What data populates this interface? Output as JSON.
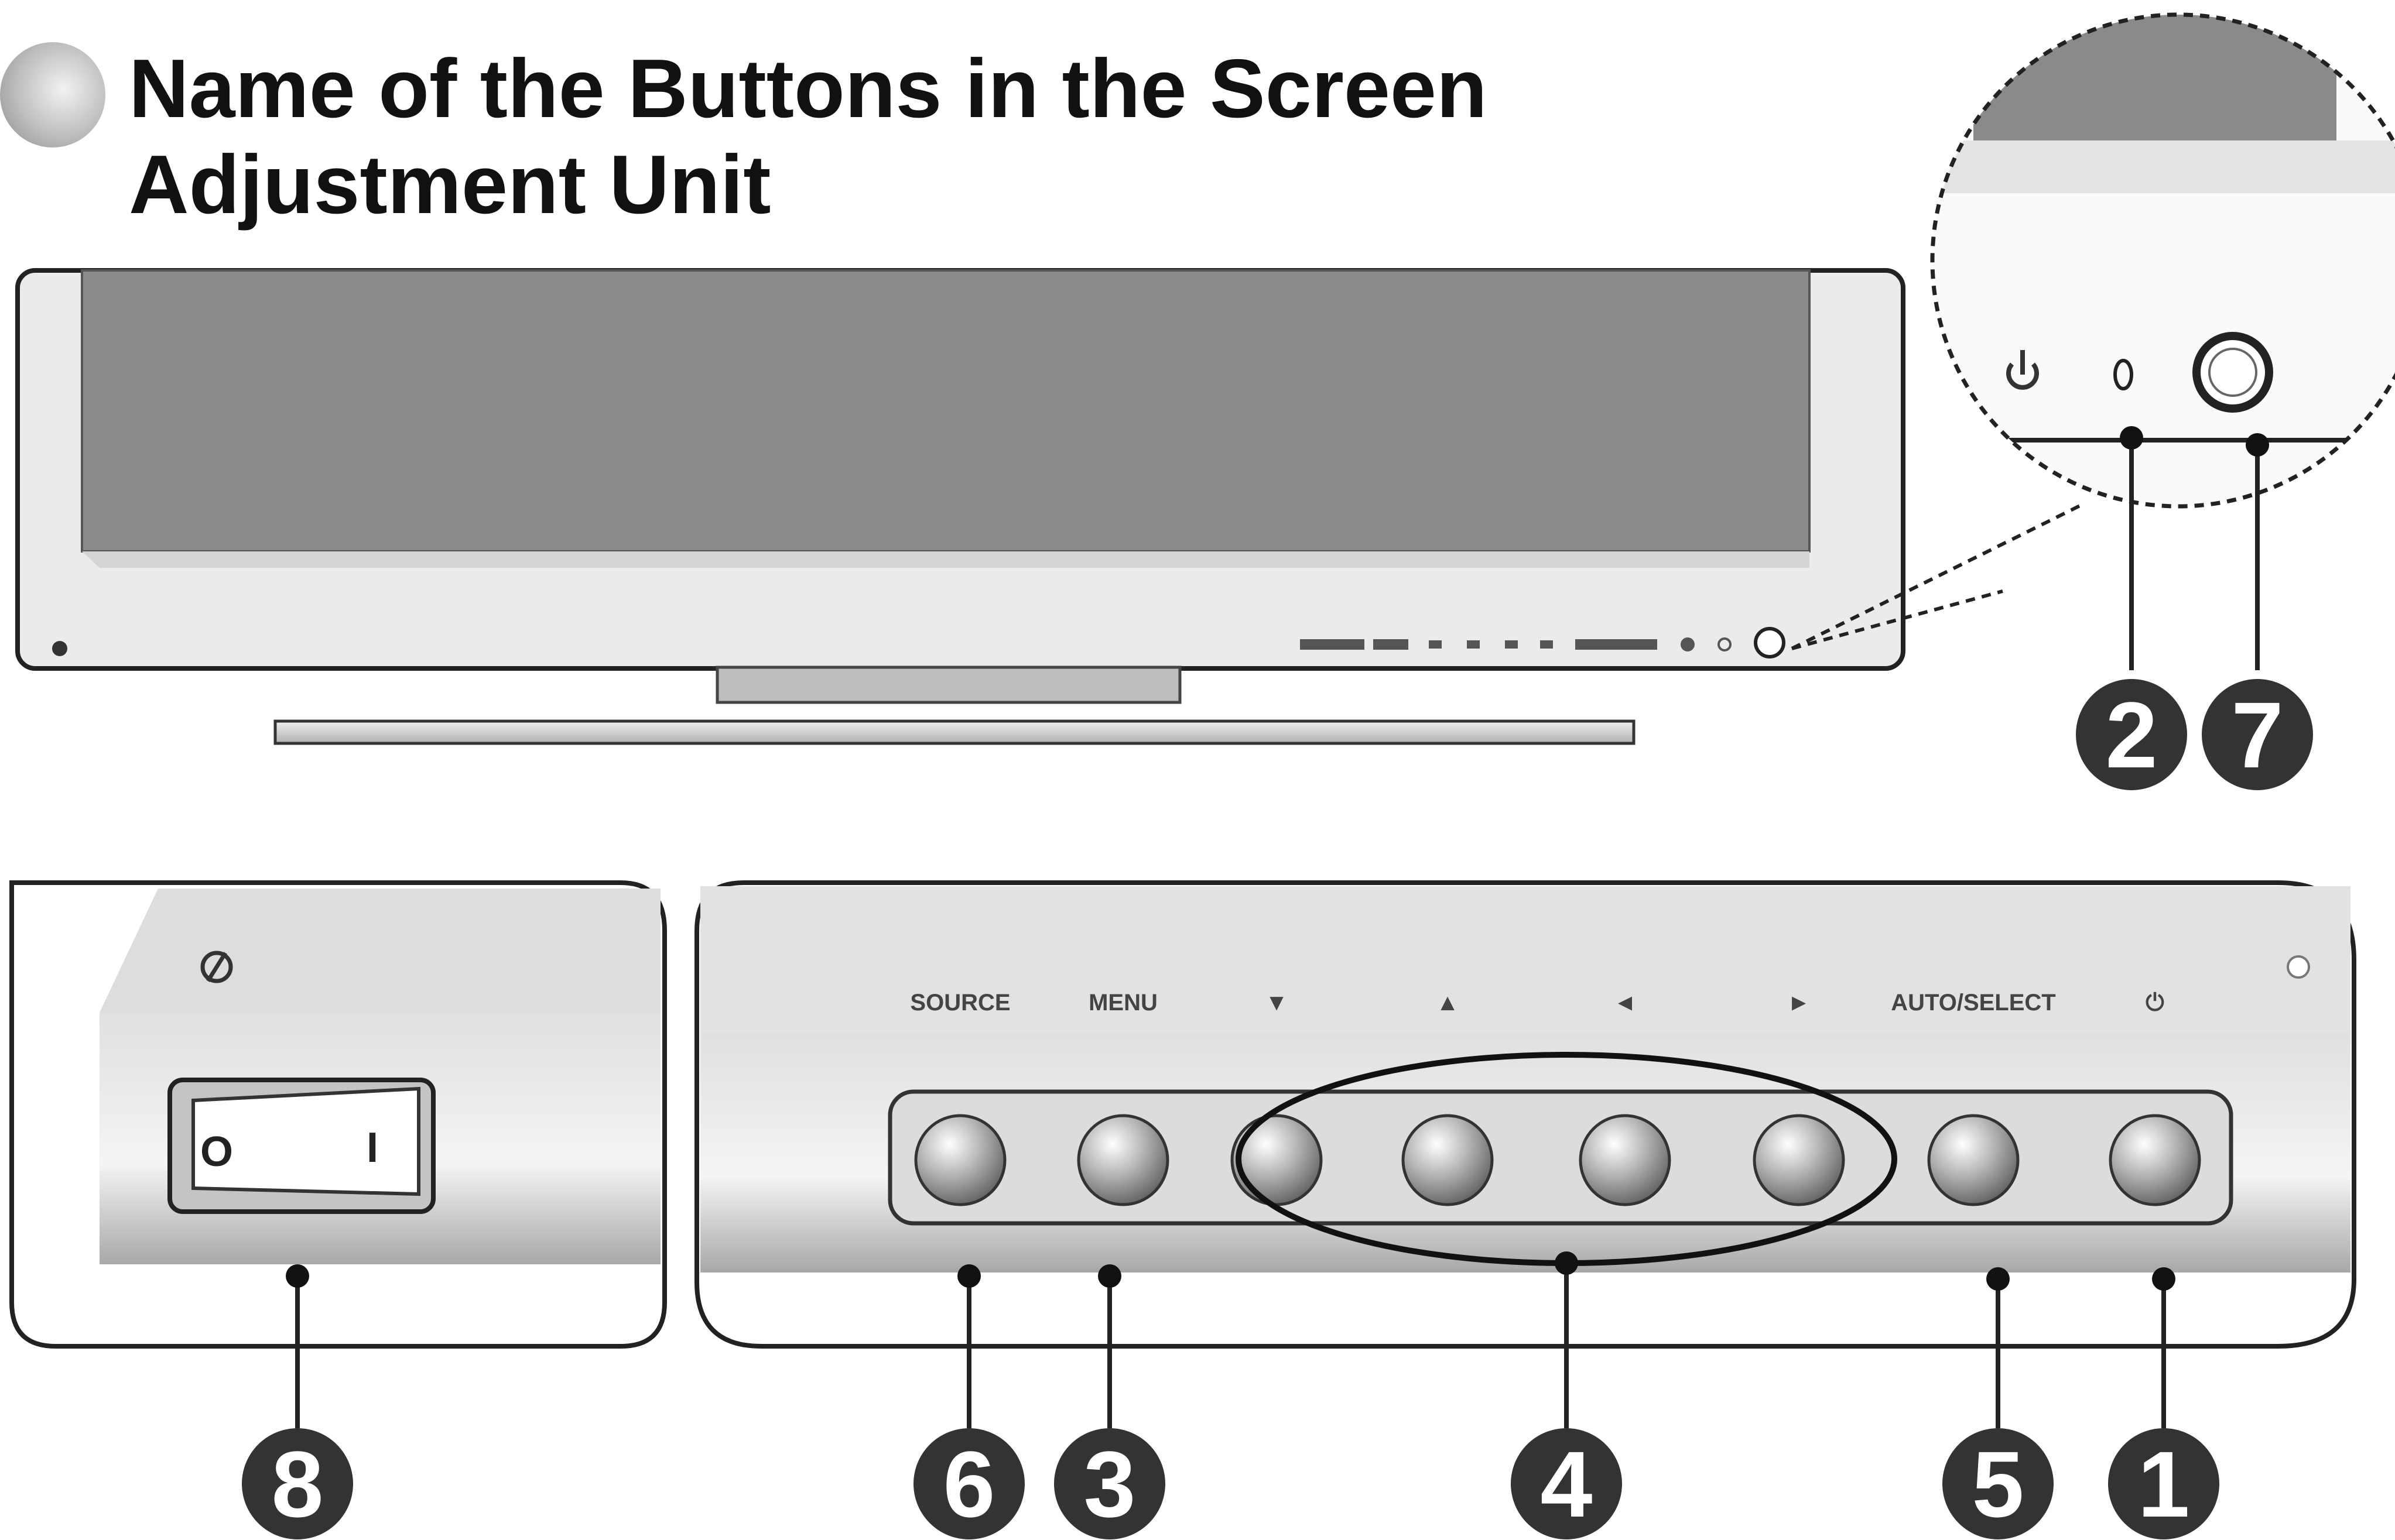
{
  "title": {
    "line1": "Name of the Buttons in the Screen",
    "line2": "Adjustment Unit"
  },
  "panel_labels": [
    "SOURCE",
    "MENU",
    "▼",
    "▲",
    "◄",
    "►",
    "AUTO/SELECT",
    "⏻"
  ],
  "callouts": {
    "power_indicator": "2",
    "power_button": "7",
    "source_button": "6",
    "menu_button": "3",
    "arrow_buttons": "4",
    "auto_select_button": "5",
    "power_panel_button": "1",
    "main_power_switch": "8"
  },
  "switch_marks": {
    "off": "O",
    "on": "I"
  },
  "icons": [
    "power-icon",
    "power-indicator-icon",
    "power-switch-icon",
    "rocker-switch-icon"
  ],
  "colors": {
    "screen": "#888888",
    "bezel": "#e9e9e9",
    "callout": "#333333",
    "outline": "#222222"
  }
}
